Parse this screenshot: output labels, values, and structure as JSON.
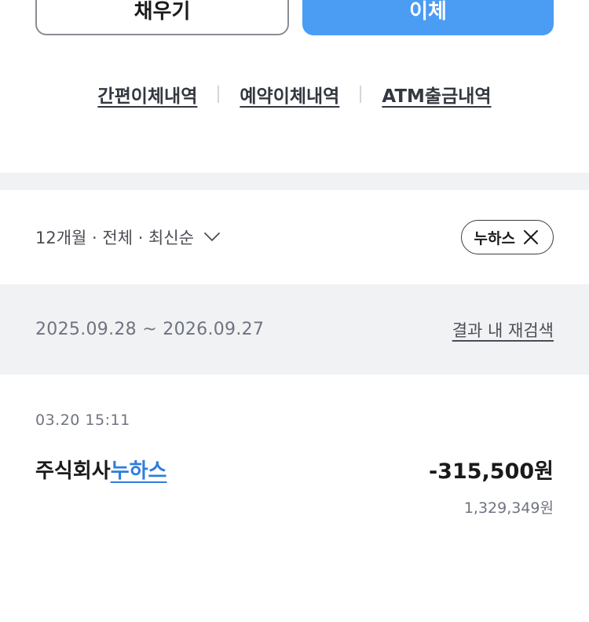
{
  "actions": {
    "refill_label": "채우기",
    "transfer_label": "이체"
  },
  "history_links": [
    {
      "label": "간편이체내역"
    },
    {
      "label": "예약이체내역"
    },
    {
      "label": "ATM출금내역"
    }
  ],
  "filter": {
    "summary": "12개월 · 전체 · 최신순",
    "chip_label": "누하스"
  },
  "range": {
    "text": "2025.09.28 ~ 2026.09.27",
    "research_label": "결과 내 재검색"
  },
  "transactions": [
    {
      "datetime": "03.20 15:11",
      "name_prefix": "주식회사",
      "name_highlight": "누하스",
      "amount": "-315,500원",
      "balance": "1,329,349원"
    }
  ],
  "colors": {
    "accent": "#4b9cf3",
    "highlight": "#2f7ddb",
    "band": "#f1f2f4"
  }
}
